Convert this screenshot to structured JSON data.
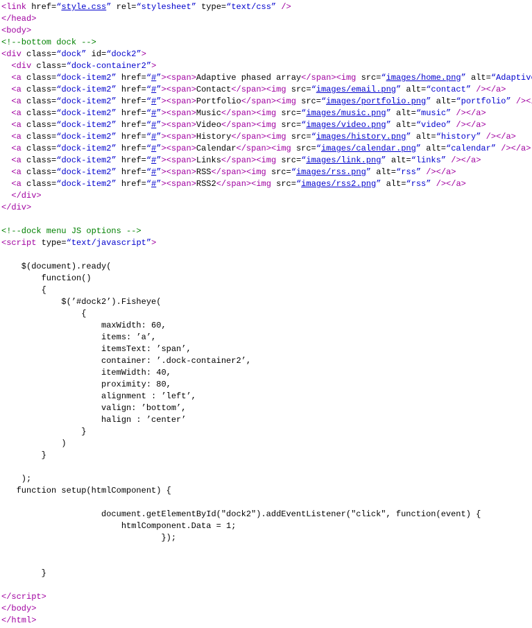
{
  "lines": {
    "link_href": "style.css",
    "link_rel": "stylesheet",
    "link_type": "text/css",
    "comment_dock": "bottom dock",
    "div_class": "dock",
    "div_id": "dock2",
    "inner_div_class": "dock-container2",
    "item_class": "dock-item2",
    "href_hash": "#",
    "items": [
      {
        "label": "Adaptive phased array",
        "img": "images/home.png",
        "alt": "Adaptive phased arr"
      },
      {
        "label": "Contact",
        "img": "images/email.png",
        "alt": "contact"
      },
      {
        "label": "Portfolio",
        "img": "images/portfolio.png",
        "alt": "portfolio"
      },
      {
        "label": "Music",
        "img": "images/music.png",
        "alt": "music"
      },
      {
        "label": "Video",
        "img": "images/video.png",
        "alt": "video"
      },
      {
        "label": "History",
        "img": "images/history.png",
        "alt": "history"
      },
      {
        "label": "Calendar",
        "img": "images/calendar.png",
        "alt": "calendar"
      },
      {
        "label": "Links",
        "img": "images/link.png",
        "alt": "links"
      },
      {
        "label": "RSS",
        "img": "images/rss.png",
        "alt": "rss"
      },
      {
        "label": "RSS2",
        "img": "images/rss2.png",
        "alt": "rss"
      }
    ],
    "comment_js": "dock menu JS options",
    "script_type": "text/javascript",
    "js_code": [
      "",
      "    $(document).ready(",
      "        function()",
      "        {",
      "            $('#dock2').Fisheye(",
      "                {",
      "                    maxWidth: 60,",
      "                    items: 'a',",
      "                    itemsText: 'span',",
      "                    container: '.dock-container2',",
      "                    itemWidth: 40,",
      "                    proximity: 80,",
      "                    alignment : 'left',",
      "                    valign: 'bottom',",
      "                    halign : 'center'",
      "                }",
      "            )",
      "        }",
      "",
      "    );",
      "   function setup(htmlComponent) {",
      "",
      "                    document.getElementById(\"dock2\").addEventListener(\"click\", function(event) {",
      "                        htmlComponent.Data = 1;",
      "                                });",
      "",
      "",
      "        }",
      ""
    ]
  }
}
